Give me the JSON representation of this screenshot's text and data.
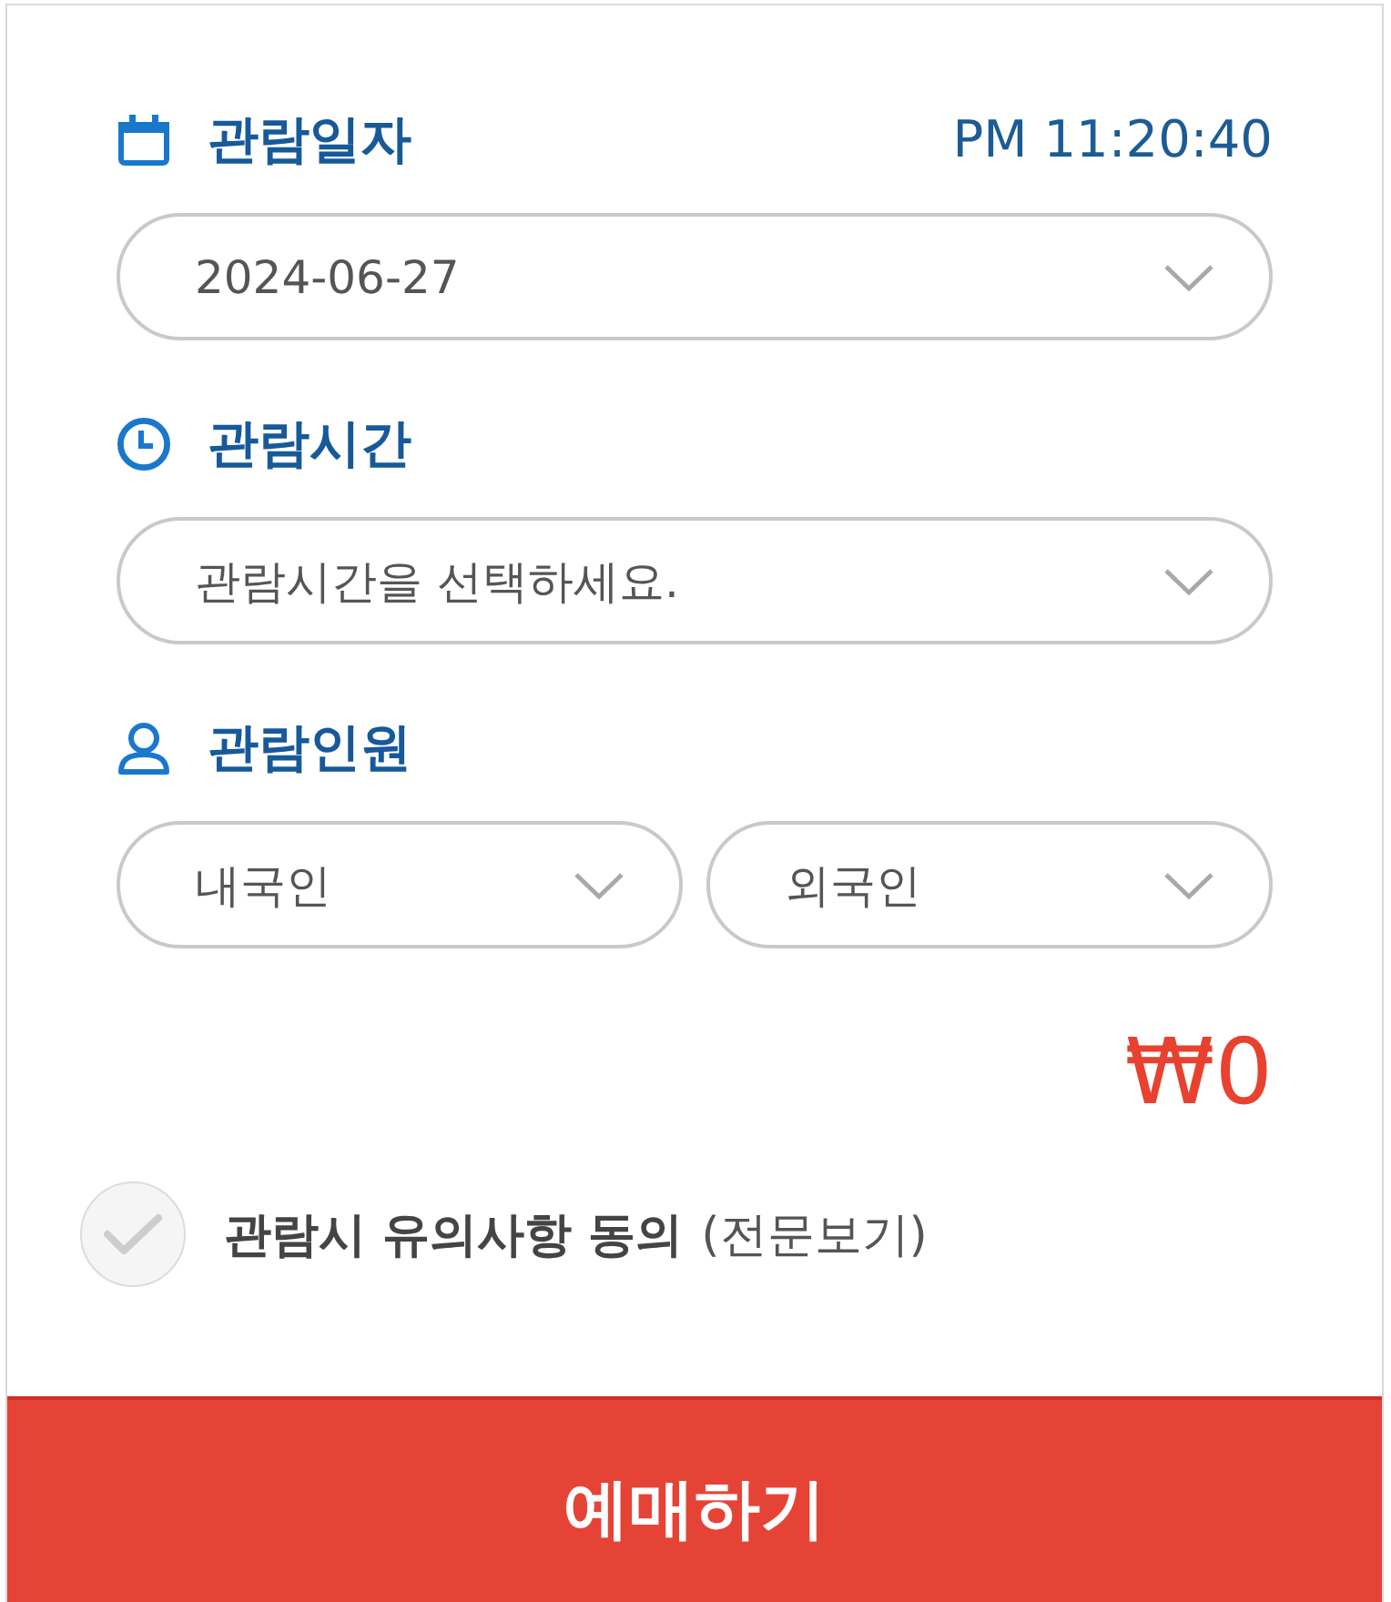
{
  "visit_date": {
    "label": "관람일자",
    "clock": "PM 11:20:40",
    "select": {
      "value": "2024-06-27"
    }
  },
  "visit_time": {
    "label": "관람시간",
    "select": {
      "value": "관람시간을 선택하세요."
    }
  },
  "visitors": {
    "label": "관람인원",
    "selects": [
      {
        "value": "내국인"
      },
      {
        "value": "외국인"
      }
    ]
  },
  "total": "₩0",
  "agreement": {
    "checked": false,
    "label": "관람시 유의사항 동의",
    "link": "(전문보기)"
  },
  "submit_button": "예매하기"
}
